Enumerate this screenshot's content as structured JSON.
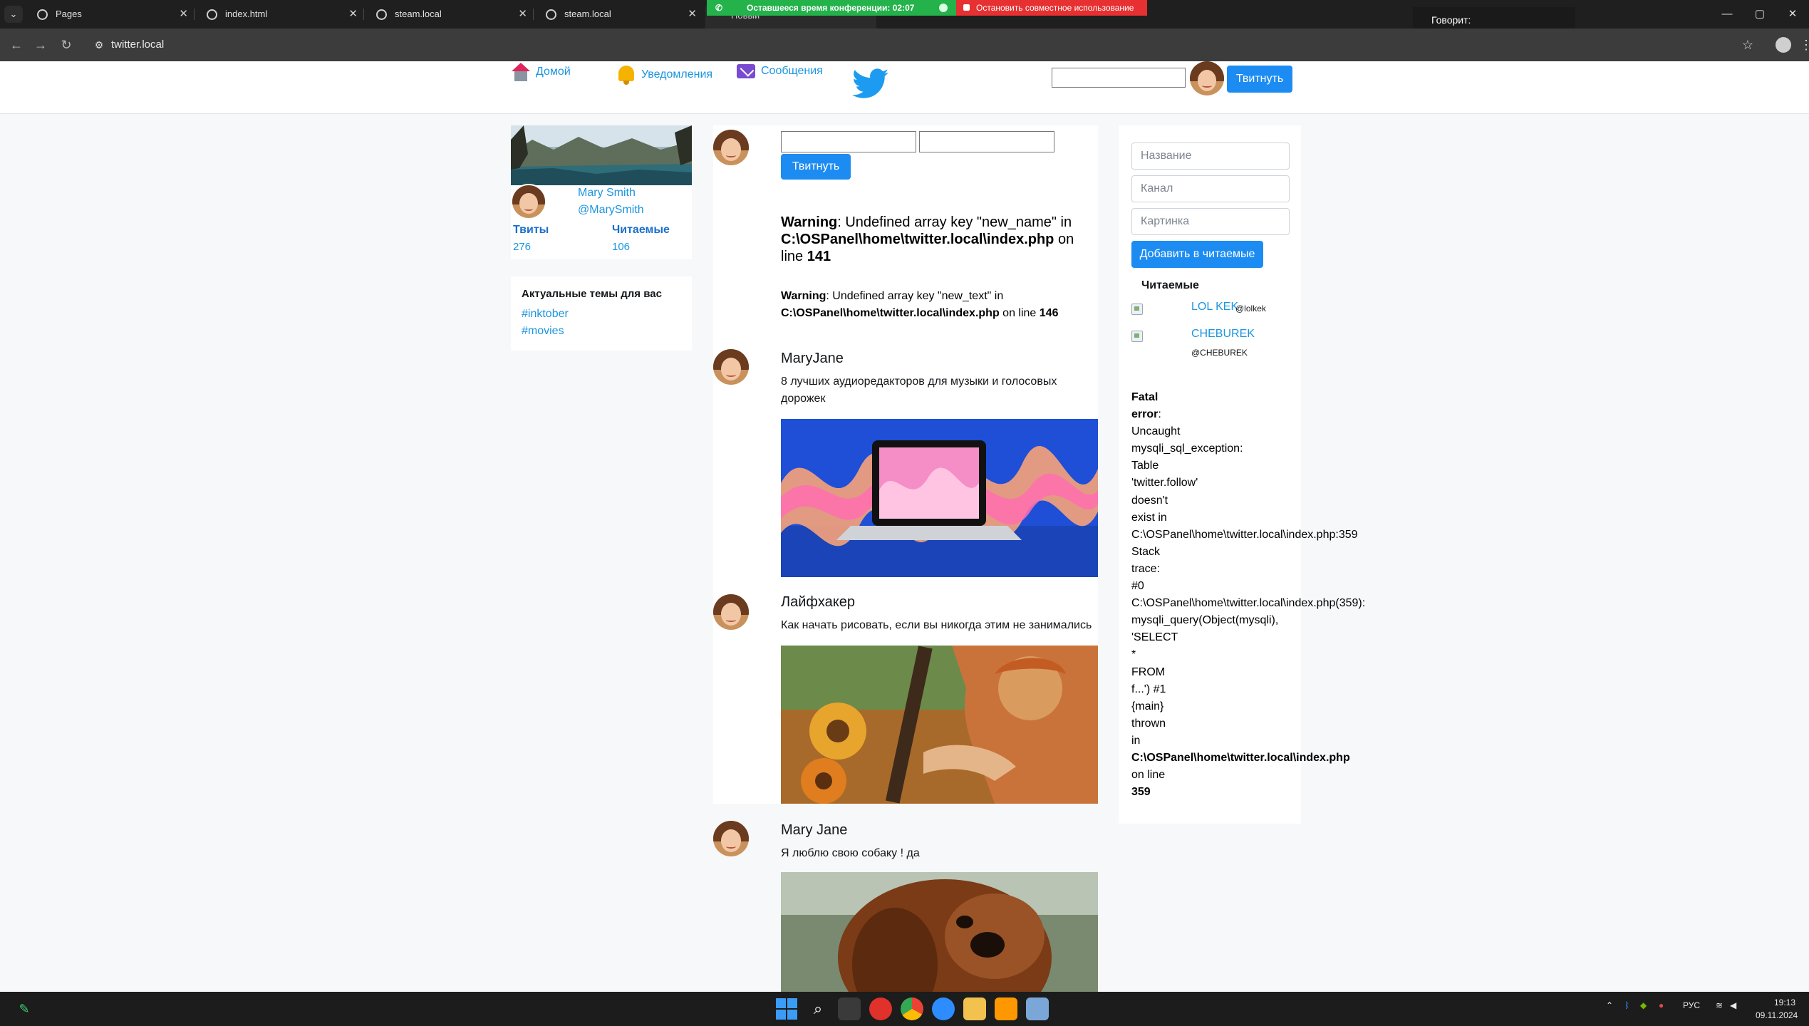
{
  "browser": {
    "tabs": [
      {
        "title": "Pages"
      },
      {
        "title": "index.html"
      },
      {
        "title": "steam.local"
      },
      {
        "title": "steam.local"
      },
      {
        "title": "Новый"
      }
    ],
    "tab_close_glyph": "✕",
    "address": "twitter.local",
    "conference_timer": "Оставшееся время конференции: 02:07",
    "stop_sharing": "Остановить совместное использование",
    "speaking_label": "Говорит:",
    "window_controls": {
      "minimize": "—",
      "maximize": "▢",
      "close": "✕"
    }
  },
  "header": {
    "nav": {
      "home": "Домой",
      "notifications": "Уведомления",
      "messages": "Сообщения"
    },
    "search_value": "",
    "tweet_button": "Твитнуть",
    "logo_icon": "twitter-bird-icon",
    "brand_color": "#1d9bf0"
  },
  "profile": {
    "name": "Mary Smith",
    "handle": "@MarySmith",
    "tweets_label": "Твиты",
    "tweets_count": "276",
    "following_label": "Читаемые",
    "following_count": "106"
  },
  "trends": {
    "title": "Актуальные темы для вас",
    "items": [
      "#inktober",
      "#movies"
    ]
  },
  "composer": {
    "name_value": "",
    "text_value": "",
    "button": "Твитнуть"
  },
  "warnings": [
    {
      "label": "Warning",
      "message": ": Undefined array key \"new_name\" in",
      "file": "C:\\OSPanel\\home\\twitter.local\\index.php",
      "on_line": " on line ",
      "line": "141"
    },
    {
      "label": "Warning",
      "message": ": Undefined array key \"new_text\" in",
      "file": "C:\\OSPanel\\home\\twitter.local\\index.php",
      "on_line": " on line ",
      "line": "146"
    }
  ],
  "tweets": [
    {
      "author": "MaryJane",
      "text": "8 лучших аудиоредакторов для музыки и голосовых дорожек",
      "image": "laptop-sound-waves"
    },
    {
      "author": "Лайфхакер",
      "text": "Как начать рисовать, если вы никогда этим не занимались",
      "image": "painting-sunflowers"
    },
    {
      "author": "Mary Jane",
      "text": "Я люблю свою собаку ! да",
      "image": "bloodhound-dog"
    }
  ],
  "follow_form": {
    "title_placeholder": "Название",
    "channel_placeholder": "Канал",
    "image_placeholder": "Картинка",
    "button": "Добавить в читаемые"
  },
  "following": {
    "title": "Читаемые",
    "items": [
      {
        "name": "LOL KEK",
        "handle": "@lolkek"
      },
      {
        "name": "CHEBUREK",
        "handle": "@CHEBUREK"
      }
    ]
  },
  "fatal_error": {
    "label1": "Fatal",
    "label2": "error",
    "colon": ":",
    "lines": [
      "Uncaught",
      "mysqli_sql_exception:",
      "Table",
      "'twitter.follow'",
      "doesn't",
      "exist in",
      "C:\\OSPanel\\home\\twitter.local\\index.php:359",
      "Stack",
      "trace:",
      "#0",
      "C:\\OSPanel\\home\\twitter.local\\index.php(359):",
      "mysqli_query(Object(mysqli),",
      "'SELECT",
      "*",
      "FROM",
      "f...') #1",
      "{main}",
      "thrown",
      "in"
    ],
    "file": "C:\\OSPanel\\home\\twitter.local\\index.php",
    "on_line": "on line",
    "line": "359"
  },
  "taskbar": {
    "language": "РУС",
    "time": "19:13",
    "date": "09.11.2024"
  }
}
